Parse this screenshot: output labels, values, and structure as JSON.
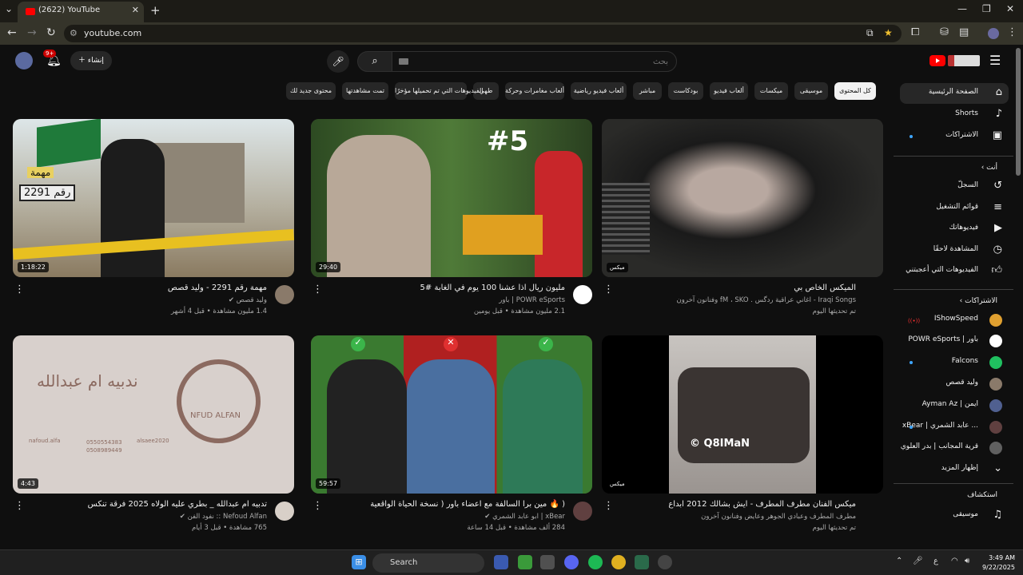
{
  "browser": {
    "tab_title": "(2622) YouTube",
    "url": "youtube.com"
  },
  "header": {
    "notif_count": "9+",
    "create_label": "إنشاء",
    "search_placeholder": "بحث"
  },
  "chips": [
    {
      "label": "كل المحتوى",
      "active": true
    },
    {
      "label": "موسيقى",
      "active": false
    },
    {
      "label": "ميكسات",
      "active": false
    },
    {
      "label": "ألعاب فيديو",
      "active": false
    },
    {
      "label": "بودكاست",
      "active": false
    },
    {
      "label": "مباشر",
      "active": false
    },
    {
      "label": "ألعاب فيديو رياضية",
      "active": false
    },
    {
      "label": "ألعاب مغامرات وحركة",
      "active": false
    },
    {
      "label": "طهي",
      "active": false
    },
    {
      "label": "الفيديوهات التي تم تحميلها مؤخرًا",
      "active": false
    },
    {
      "label": "تمت مشاهدتها",
      "active": false
    },
    {
      "label": "محتوى جديد لك",
      "active": false
    }
  ],
  "sidebar": {
    "main": [
      {
        "label": "الصفحة الرئيسية",
        "icon": "home-icon"
      },
      {
        "label": "Shorts",
        "icon": "shorts-icon"
      },
      {
        "label": "الاشتراكات",
        "icon": "subscriptions-icon"
      }
    ],
    "you_heading": "أنت",
    "you": [
      {
        "label": "السجلّ",
        "icon": "history-icon"
      },
      {
        "label": "قوائم التشغيل",
        "icon": "playlist-icon"
      },
      {
        "label": "فيديوهاتك",
        "icon": "your-videos-icon"
      },
      {
        "label": "المشاهدة لاحقًا",
        "icon": "watch-later-icon"
      },
      {
        "label": "الفيديوهات التي أعجبتني",
        "icon": "like-icon"
      }
    ],
    "subs_heading": "الاشتراكات",
    "subs": [
      {
        "label": "IShowSpeed",
        "color": "#e0a030"
      },
      {
        "label": "POWR eSports | باور",
        "color": "#ffffff"
      },
      {
        "label": "Falcons",
        "color": "#20c060"
      },
      {
        "label": "وليد قصص",
        "color": "#8a7a6a"
      },
      {
        "label": "Ayman Az | ايمن",
        "color": "#506090"
      },
      {
        "label": "xBear | عابد الشمري ...",
        "color": "#604040"
      },
      {
        "label": "قرية المجانب | بدر العلوي",
        "color": "#606060"
      }
    ],
    "show_more": "إظهار المزيد",
    "explore_heading": "استكشاف",
    "explore": [
      {
        "label": "موسيقى",
        "icon": "music-icon"
      }
    ]
  },
  "videos": [
    {
      "title": "مهمة رقم 2291 - وليد قصص",
      "channel": "وليد قصص",
      "verified": true,
      "stats": "1.4 مليون مشاهدة • قبل 4 أشهر",
      "duration": "1:18:22",
      "av_color": "#8a7a6a",
      "thumb": "#4a4a3a"
    },
    {
      "title": "مليون ريال اذا عشنا 100 يوم في الغابة #5",
      "channel": "POWR eSports | باور",
      "verified": false,
      "stats": "2.1 مليون مشاهدة • قبل يومين",
      "duration": "29:40",
      "av_color": "#ffffff",
      "thumb": "#3d5a2e"
    },
    {
      "title": "الميكس الخاص بي",
      "channel": "Iraqi Songs - اغاني عراقية ردگس . fM ، SKO وفنانون آخرون",
      "verified": false,
      "stats": "تم تحديثها اليوم",
      "duration": "ميكس",
      "av_color": "",
      "thumb": "#2a2a2a"
    },
    {
      "title": "تدبيه ام عبدالله _ بطري عليه الولاه 2025 فرقة تنكس",
      "channel": "Nefoud Alfan :: نفود الفن",
      "verified": true,
      "stats": "765 مشاهدة • قبل 3 أيام",
      "duration": "4:43",
      "av_color": "#d8d0c8",
      "thumb": "#d8d0cc"
    },
    {
      "title": "( 🔥 مين برا السالفة مع اعضاء باور ( نسخة الحياة الواقعية",
      "channel": "xBear | ابو عابد الشمري",
      "verified": true,
      "stats": "284 ألف مشاهدة • قبل 14 ساعة",
      "duration": "59:57",
      "av_color": "#604040",
      "thumb": "#5a4030"
    },
    {
      "title": "ميكس الفنان مطرف المطرف - ايش بشالك 2012 ابداع",
      "channel": "مطرف المطرف وعبادي الجوهر وعايض وفنانون آخرون",
      "verified": false,
      "stats": "تم تحديثها اليوم",
      "duration": "ميكس",
      "av_color": "",
      "thumb": "#000000"
    }
  ],
  "thumb_texts": {
    "v1_mission": "مهمة",
    "v1_number": "رقم 2291",
    "v2_episode": "#5",
    "v4_brand": "NFUD ALFAN",
    "v4_script": "ندبيه ام عبدالله",
    "v4_contact1": "nafoud.alfa",
    "v4_contact2": "0550554383",
    "v4_contact3": "0508989449",
    "v4_contact4": "alsaee2020",
    "v6_watermark": "© Q8IMaN"
  },
  "taskbar": {
    "search_label": "Search",
    "time": "3:49 AM",
    "date": "9/22/2025",
    "lang": "ع"
  }
}
